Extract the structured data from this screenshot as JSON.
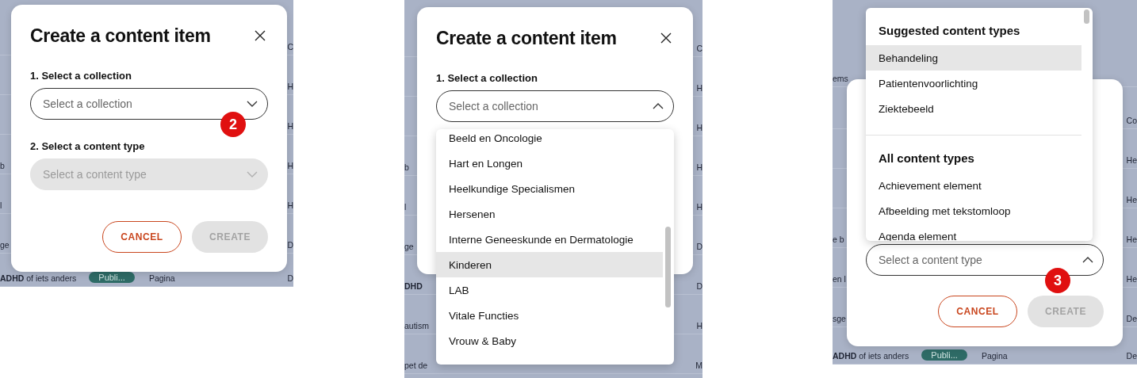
{
  "panels": [
    {
      "kind": "collection-closed",
      "backdrop": [
        {
          "right": "C"
        },
        {
          "right": "H"
        },
        {
          "right": "H"
        },
        {
          "left": "b",
          "right": "H"
        },
        {
          "left": "l",
          "right": "H"
        },
        {
          "left": "ge",
          "right": "D"
        },
        {
          "left": "**ADHD** of iets anders",
          "badge": "Publi...",
          "type": "Pagina",
          "right": "D"
        }
      ],
      "dialog": {
        "title": "Create a content item",
        "fields": [
          {
            "label": "1. Select a collection",
            "placeholder": "Select a collection",
            "disabled": false,
            "expanded": false,
            "step": "2"
          },
          {
            "label": "2. Select a content type",
            "placeholder": "Select a content type",
            "disabled": true,
            "expanded": false
          }
        ],
        "buttons": [
          {
            "kind": "cancel",
            "label": "CANCEL",
            "disabled": false
          },
          {
            "kind": "create",
            "label": "CREATE",
            "disabled": true
          }
        ]
      }
    },
    {
      "kind": "collection-open",
      "backdrop": [
        {
          "right": "C"
        },
        {
          "right": "H"
        },
        {
          "right": "H"
        },
        {
          "left": "b",
          "right": "H"
        },
        {
          "left": "l",
          "right": "H"
        },
        {
          "left": "ge",
          "right": "D"
        },
        {
          "left": "DHD",
          "bold": true,
          "right": "D"
        },
        {
          "left": "autism",
          "right": "H"
        },
        {
          "left": "pet de",
          "right": "M"
        }
      ],
      "dialog": {
        "title": "Create a content item",
        "fields": [
          {
            "label": "1. Select a collection",
            "placeholder": "Select a collection",
            "disabled": false,
            "expanded": true
          }
        ]
      },
      "dropdown": {
        "groups": [
          {
            "options": [
              {
                "label": "Beeld en Oncologie",
                "selected": false
              },
              {
                "label": "Hart en Longen",
                "selected": false
              },
              {
                "label": "Heelkundige Specialismen",
                "selected": false
              },
              {
                "label": "Hersenen",
                "selected": false
              },
              {
                "label": "Interne Geneeskunde en Dermatologie",
                "selected": false
              },
              {
                "label": "Kinderen",
                "selected": true
              },
              {
                "label": "LAB",
                "selected": false
              },
              {
                "label": "Vitale Functies",
                "selected": false
              },
              {
                "label": "Vrouw & Baby",
                "selected": false
              }
            ]
          }
        ]
      }
    },
    {
      "kind": "type-open",
      "backdrop": [
        {
          "left": "ems"
        },
        {
          "right": "Co"
        },
        {
          "right": "He"
        },
        {
          "right": "He"
        },
        {
          "left": "e b",
          "right": "He"
        },
        {
          "left": "en l",
          "right": "He"
        },
        {
          "left": "sge",
          "right": "De"
        },
        {
          "left": "**ADHD** of iets anders",
          "badge": "Publi...",
          "type": "Pagina",
          "right": "De"
        }
      ],
      "dialog": {
        "fields": [
          {
            "placeholder": "Select a content type",
            "disabled": false,
            "expanded": true,
            "step": "3"
          }
        ],
        "buttons": [
          {
            "kind": "cancel",
            "label": "CANCEL",
            "disabled": false
          },
          {
            "kind": "create",
            "label": "CREATE",
            "disabled": true
          }
        ]
      },
      "dropdown": {
        "groups": [
          {
            "heading": "Suggested content types",
            "options": [
              {
                "label": "Behandeling",
                "selected": true
              },
              {
                "label": "Patientenvoorlichting",
                "selected": false
              },
              {
                "label": "Ziektebeeld",
                "selected": false
              }
            ]
          },
          {
            "heading": "All content types",
            "options": [
              {
                "label": "Achievement element",
                "selected": false
              },
              {
                "label": "Afbeelding met tekstomloop",
                "selected": false
              },
              {
                "label": "Agenda element",
                "selected": false
              }
            ]
          }
        ]
      }
    }
  ]
}
